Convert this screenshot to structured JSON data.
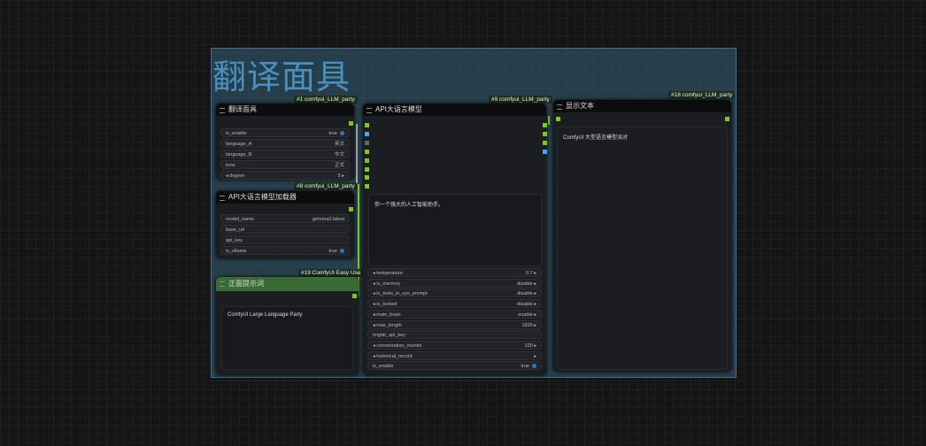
{
  "group": {
    "title": "翻译面具"
  },
  "nodes": {
    "n1": {
      "badge": "#1 comfyui_LLM_party",
      "title": "翻译面具",
      "widgets": [
        {
          "label": "is_enable",
          "value": "true",
          "toggle": true
        },
        {
          "label": "language_A",
          "value": "英文"
        },
        {
          "label": "language_B",
          "value": "中文"
        },
        {
          "label": "tone",
          "value": "正式"
        },
        {
          "label": "degree",
          "value": "5",
          "arrows": true
        }
      ]
    },
    "n8": {
      "badge": "#8 comfyui_LLM_party",
      "title": "API大语言模型加载器",
      "widgets": [
        {
          "label": "model_name",
          "value": "gemma2:latest"
        },
        {
          "label": "base_url",
          "value": ""
        },
        {
          "label": "api_key",
          "value": ""
        },
        {
          "label": "is_ollama",
          "value": "true",
          "toggle": true
        }
      ]
    },
    "n19": {
      "badge": "#19 ComfyUI Easy Use",
      "title": "正面提示词",
      "text": "ComfyUI Large Language Party",
      "color": "#3a6b35"
    },
    "n9": {
      "badge": "#9 comfyui_LLM_party",
      "title": "API大语言模型",
      "system_prompt": "你一个强大的人工智能助手。",
      "widgets": [
        {
          "label": "temperature",
          "value": "0.7",
          "arrows": true
        },
        {
          "label": "is_memory",
          "value": "disable",
          "arrows": true
        },
        {
          "label": "is_tools_in_sys_prompt",
          "value": "disable",
          "arrows": true
        },
        {
          "label": "is_locked",
          "value": "disable",
          "arrows": true
        },
        {
          "label": "main_brain",
          "value": "enable",
          "arrows": true
        },
        {
          "label": "max_length",
          "value": "1920",
          "arrows": true
        },
        {
          "label": "imgbb_api_key",
          "value": ""
        },
        {
          "label": "conversation_rounds",
          "value": "100",
          "arrows": true
        },
        {
          "label": "historical_record",
          "value": "",
          "arrows": true
        },
        {
          "label": "is_enable",
          "value": "true",
          "toggle": true
        }
      ]
    },
    "n18": {
      "badge": "#18 comfyui_LLM_party",
      "title": "显示文本",
      "text": "ComfyUI 大型语言模型派对"
    }
  }
}
